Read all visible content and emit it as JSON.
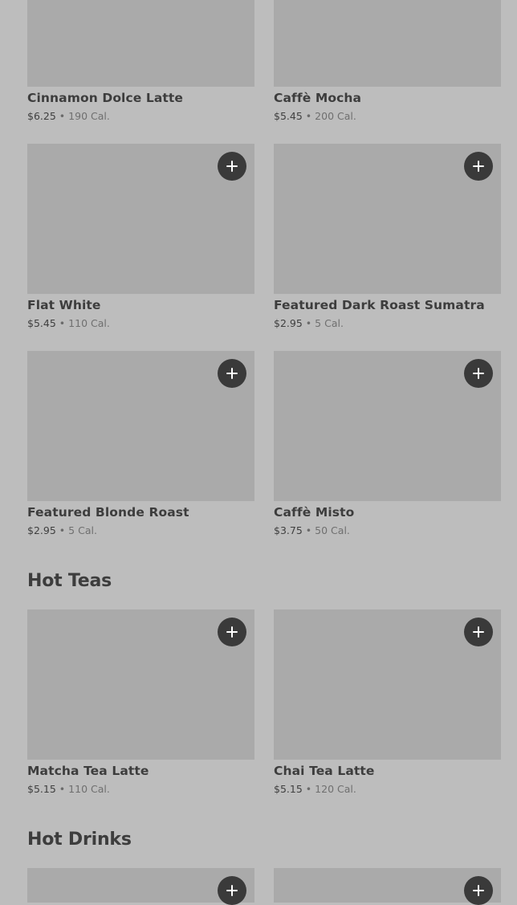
{
  "menu": {
    "top_items": [
      {
        "name": "Cinnamon Dolce Latte",
        "price": "$6.25",
        "calories": "190 Cal."
      },
      {
        "name": "Caffè Mocha",
        "price": "$5.45",
        "calories": "200 Cal."
      },
      {
        "name": "Flat White",
        "price": "$5.45",
        "calories": "110 Cal."
      },
      {
        "name": "Featured Dark Roast Sumatra",
        "price": "$2.95",
        "calories": "5 Cal."
      },
      {
        "name": "Featured Blonde Roast",
        "price": "$2.95",
        "calories": "5 Cal."
      },
      {
        "name": "Caffè Misto",
        "price": "$3.75",
        "calories": "50 Cal."
      }
    ],
    "hot_teas": {
      "title": "Hot Teas",
      "items": [
        {
          "name": "Matcha Tea Latte",
          "price": "$5.15",
          "calories": "110 Cal."
        },
        {
          "name": "Chai Tea Latte",
          "price": "$5.15",
          "calories": "120 Cal."
        }
      ]
    },
    "hot_drinks": {
      "title": "Hot Drinks"
    },
    "separator": "•",
    "add_icon": "plus-icon",
    "colors": {
      "background": "#bdbdbd",
      "image_placeholder": "#aaaaaa",
      "add_button": "#3a3a3a",
      "text_primary": "#3d3d3d"
    }
  }
}
